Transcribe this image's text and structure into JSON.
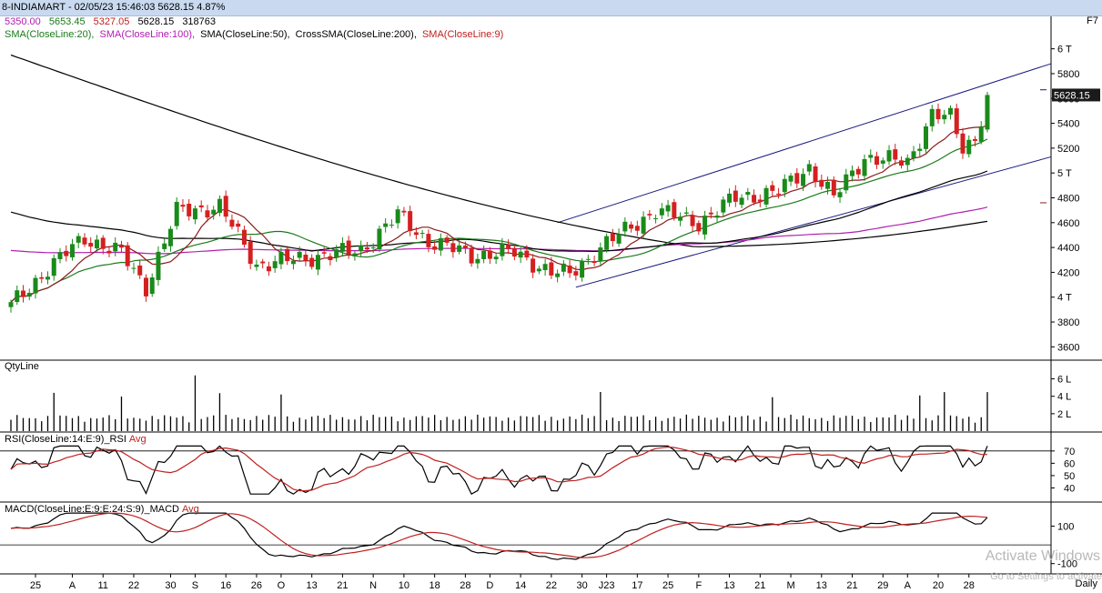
{
  "window": {
    "title": "8-INDIAMART - 02/05/23 15:46:03 5628.15 4.87%",
    "shortcut": "F7",
    "timeframe": "Daily"
  },
  "quote": {
    "open": "5350.00",
    "high": "5653.45",
    "low": "5327.05",
    "close": "5628.15",
    "volume": "318763"
  },
  "indicators": [
    {
      "label": "SMA(CloseLine:20),",
      "color": "#1a7a1a"
    },
    {
      "label": "SMA(CloseLine:100),",
      "color": "#b020b0"
    },
    {
      "label": "SMA(CloseLine:50),",
      "color": "#000000"
    },
    {
      "label": "CrossSMA(CloseLine:200),",
      "color": "#000000"
    },
    {
      "label": "SMA(CloseLine:9)",
      "color": "#c02020"
    }
  ],
  "panels": {
    "qty": {
      "label": "QtyLine"
    },
    "rsi": {
      "label_main": "RSI(CloseLine:14:E:9)_RSI",
      "label_avg": "Avg"
    },
    "macd": {
      "label_main": "MACD(CloseLine:E:9:E:24:S:9)_MACD",
      "label_avg": "Avg"
    }
  },
  "colors": {
    "up": "#1a8a1a",
    "down": "#d42020",
    "sma20": "#1a7a1a",
    "sma9": "#8b1a1a",
    "sma100": "#b020b0",
    "sma50": "#000000",
    "channel": "#1a1a80",
    "rsi_avg": "#c02020",
    "macd_avg": "#c02020"
  },
  "watermark": {
    "line1": "Activate Windows",
    "line2": "Go to Settings to activate"
  },
  "chart_data": {
    "type": "candlestick",
    "price_ticks": [
      "6 T",
      "5800",
      "5600",
      "5400",
      "5200",
      "5 T",
      "4800",
      "4600",
      "4400",
      "4200",
      "4 T",
      "3800",
      "3600"
    ],
    "price_tick_values": [
      6000,
      5800,
      5600,
      5400,
      5200,
      5000,
      4800,
      4600,
      4400,
      4200,
      4000,
      3800,
      3600
    ],
    "ylim": [
      3500,
      6100
    ],
    "last_price_label": "5628.15",
    "qty_ticks": [
      "6 L",
      "4 L",
      "2 L"
    ],
    "qty_tick_values": [
      600000,
      400000,
      200000
    ],
    "rsi_ticks": [
      "70",
      "60",
      "50",
      "40"
    ],
    "rsi_tick_values": [
      70,
      60,
      50,
      40
    ],
    "macd_ticks": [
      "100",
      "-100"
    ],
    "macd_tick_values": [
      100,
      -100
    ],
    "x_labels": [
      "25",
      "A",
      "11",
      "22",
      "30",
      "S",
      "16",
      "26",
      "O",
      "13",
      "21",
      "N",
      "10",
      "18",
      "28",
      "D",
      "14",
      "22",
      "30",
      "J23",
      "17",
      "25",
      "F",
      "13",
      "21",
      "M",
      "13",
      "21",
      "29",
      "A",
      "20",
      "28"
    ],
    "x_label_index": [
      4,
      10,
      15,
      20,
      26,
      30,
      35,
      40,
      44,
      49,
      54,
      59,
      64,
      69,
      74,
      78,
      83,
      88,
      93,
      97,
      102,
      107,
      112,
      117,
      122,
      127,
      132,
      137,
      142,
      146,
      151,
      156
    ]
  }
}
